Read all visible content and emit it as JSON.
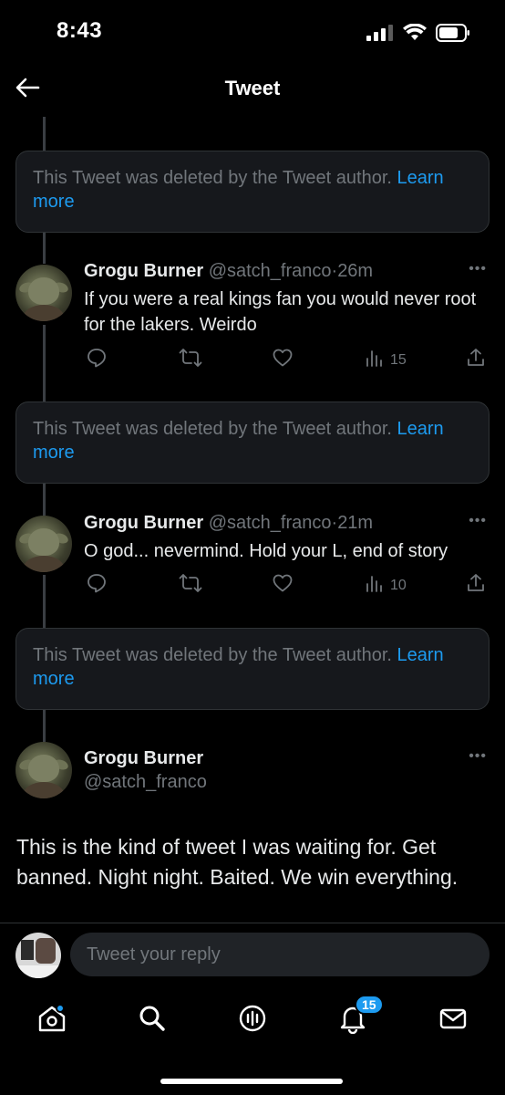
{
  "status": {
    "time": "8:43"
  },
  "header": {
    "title": "Tweet"
  },
  "deleted_notice": {
    "text": "This Tweet was deleted by the Tweet author.",
    "link": "Learn more"
  },
  "replies": [
    {
      "name": "Grogu Burner",
      "handle": "@satch_franco",
      "separator": "·",
      "time": "26m",
      "text": "If you were a real kings fan you would never root for the lakers. Weirdo",
      "views": "15"
    },
    {
      "name": "Grogu Burner",
      "handle": "@satch_franco",
      "separator": "·",
      "time": "21m",
      "text": "O god... nevermind. Hold your L, end of story",
      "views": "10"
    }
  ],
  "main_tweet": {
    "name": "Grogu Burner",
    "handle": "@satch_franco",
    "text": "This is the kind of tweet I was waiting for. Get banned. Night night. Baited. We win everything."
  },
  "reply_bar": {
    "placeholder": "Tweet your reply"
  },
  "tab_bar": {
    "notifications_badge": "15"
  },
  "colors": {
    "accent": "#1d9bf0",
    "background": "#000000",
    "muted": "#71767b",
    "card": "#16181c"
  }
}
